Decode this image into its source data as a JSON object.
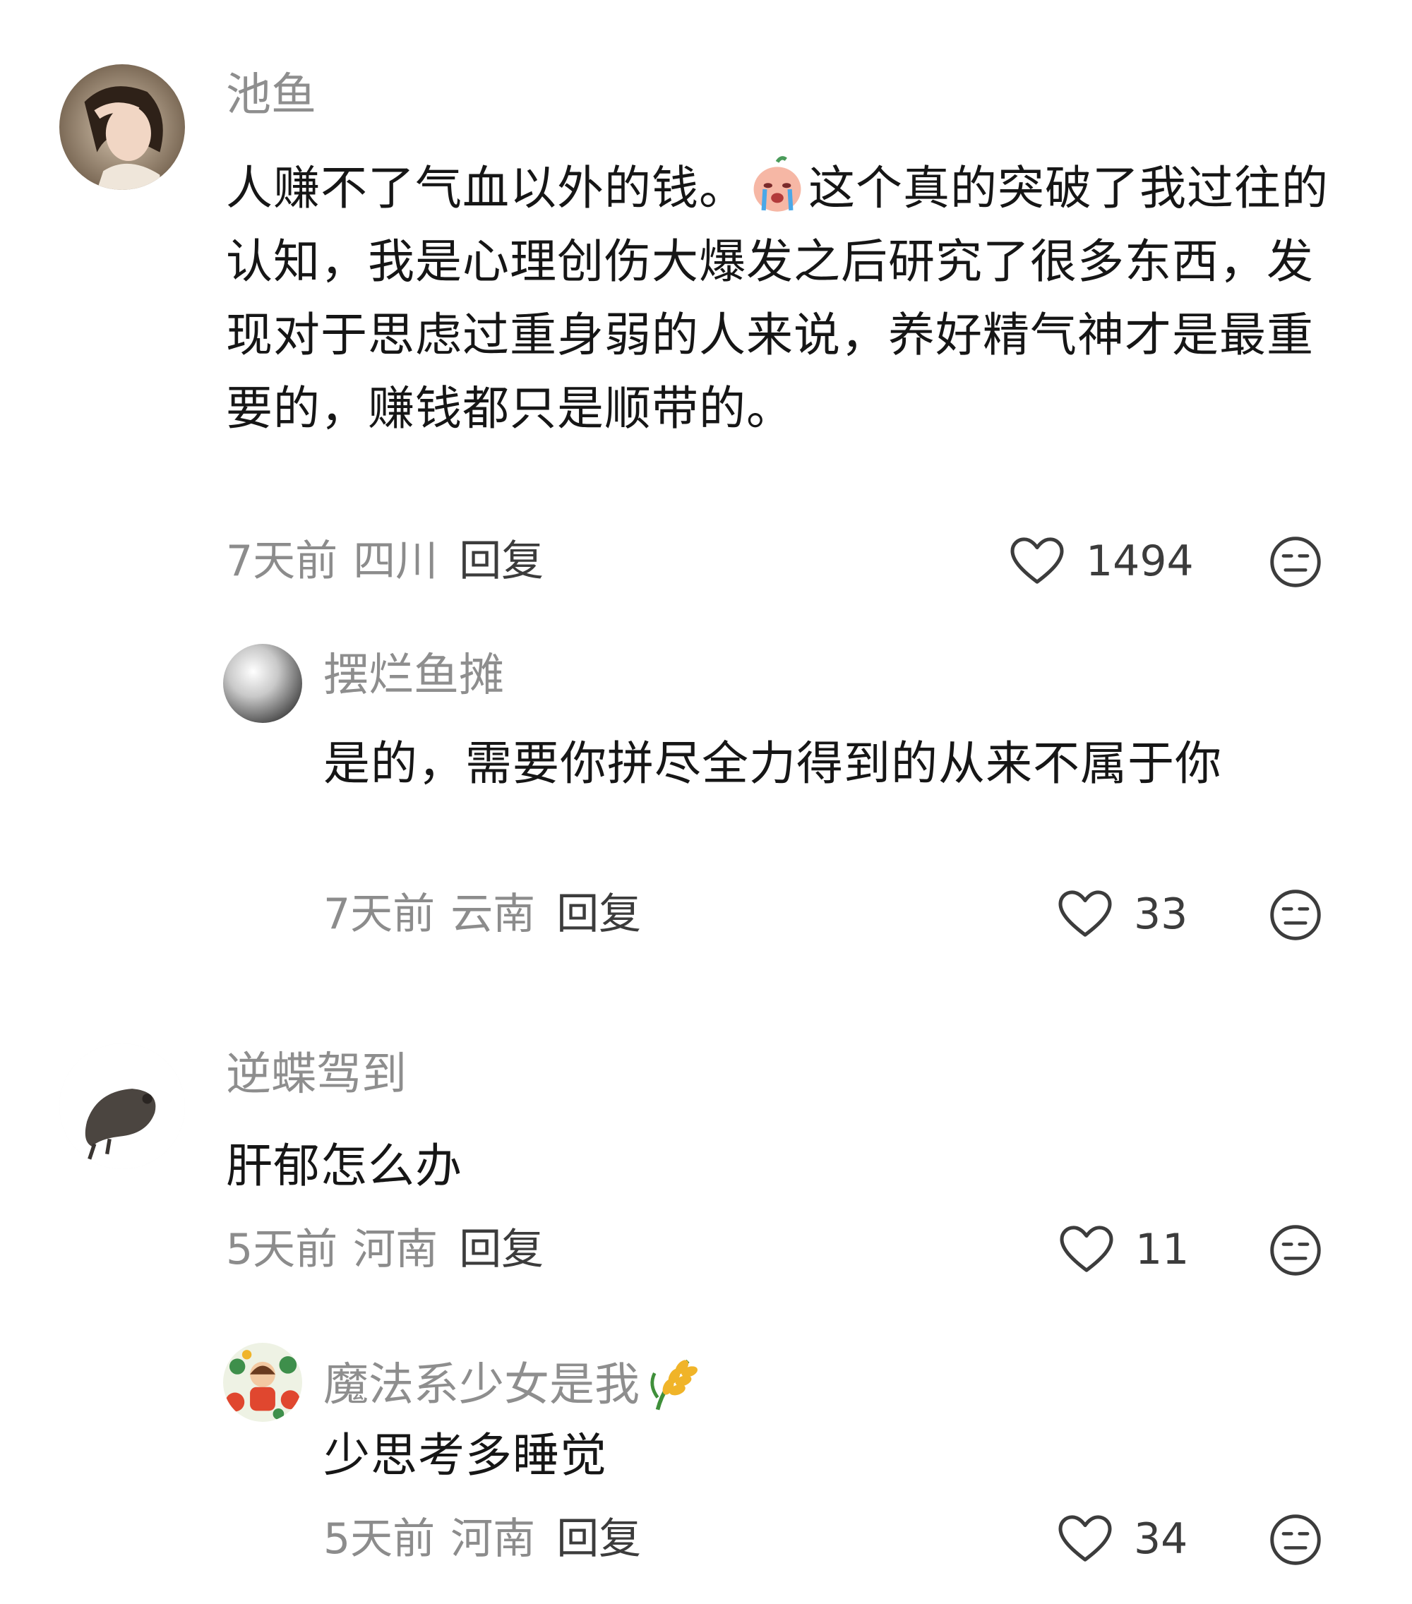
{
  "comments": [
    {
      "username": "池鱼",
      "avatar": "avatar-girl-photo",
      "text_before_emoji": "人赚不了气血以外的钱。",
      "emoji": "crying-face-emoji",
      "text_after_emoji": "这个真的突破了我过往的认知，我是心理创伤大爆发之后研究了很多东西，发现对于思虑过重身弱的人来说，养好精气神才是最重要的，赚钱都只是顺带的。",
      "time": "7天前",
      "location": "四川",
      "reply_label": "回复",
      "likes": "1494"
    },
    {
      "username": "摆烂鱼摊",
      "avatar": "avatar-pearl",
      "text": "是的，需要你拼尽全力得到的从来不属于你",
      "time": "7天前",
      "location": "云南",
      "reply_label": "回复",
      "likes": "33"
    },
    {
      "username": "逆蝶驾到",
      "avatar": "avatar-animal",
      "text": "肝郁怎么办",
      "time": "5天前",
      "location": "河南",
      "reply_label": "回复",
      "likes": "11"
    },
    {
      "username": "魔法系少女是我",
      "avatar": "avatar-cartoon-floral",
      "badge": "wheat-icon",
      "text": "少思考多睡觉",
      "time": "5天前",
      "location": "河南",
      "reply_label": "回复",
      "likes": "34"
    }
  ],
  "colors": {
    "username": "#8e8e8e",
    "text": "#161616",
    "meta": "#8c8c8c",
    "icon": "#3c3c3c"
  }
}
